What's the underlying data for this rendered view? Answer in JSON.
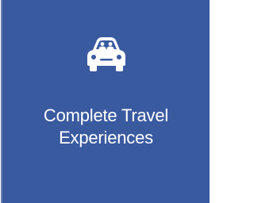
{
  "tile": {
    "background_color": "#3a5aa0",
    "icon": "car-with-passengers-icon",
    "title_lines": [
      "Complete Travel",
      "Experiences"
    ]
  }
}
